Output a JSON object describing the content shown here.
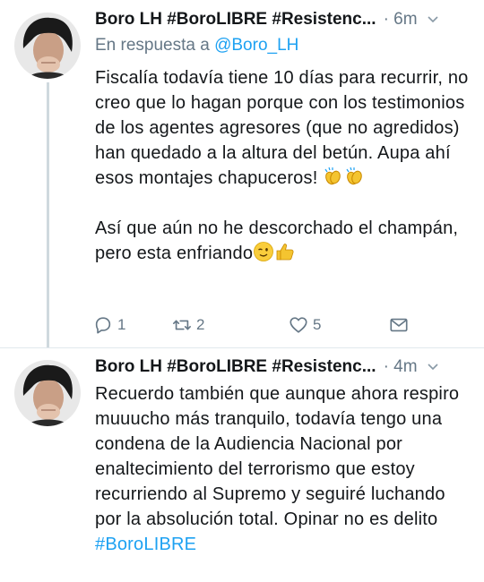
{
  "tweets": [
    {
      "author": "Boro LH #BoroLIBRE #Resistenc...",
      "time": "6m",
      "reply_prefix": "En respuesta a ",
      "reply_handle": "@Boro_LH",
      "paragraph1": "Fiscalía todavía tiene 10 días para recurrir, no creo que lo hagan porque con los testimonios de los agentes agresores (que no agredidos) han quedado a la altura del betún. Aupa ahí esos montajes chapuceros!",
      "paragraph2": "Así que aún no he descorchado el champán, pero esta enfriando",
      "emoji_1": "clapping-hands",
      "emoji_2": "winking-face",
      "emoji_3": "thumbs-up",
      "actions": {
        "replies": "1",
        "retweets": "2",
        "likes": "5"
      }
    },
    {
      "author": "Boro LH #BoroLIBRE #Resistenc...",
      "time": "4m",
      "text": "Recuerdo también que aunque ahora respiro muuucho más tranquilo, todavía tengo una condena de la Audiencia Nacional por enaltecimiento del terrorismo que estoy recurriendo al Supremo y seguiré luchando por la absolución total. Opinar no es delito",
      "hashtag": "#BoroLIBRE"
    }
  ],
  "colors": {
    "link": "#1da1f2",
    "muted": "#657786",
    "text": "#14171a",
    "thread_line": "#cfd9de"
  }
}
